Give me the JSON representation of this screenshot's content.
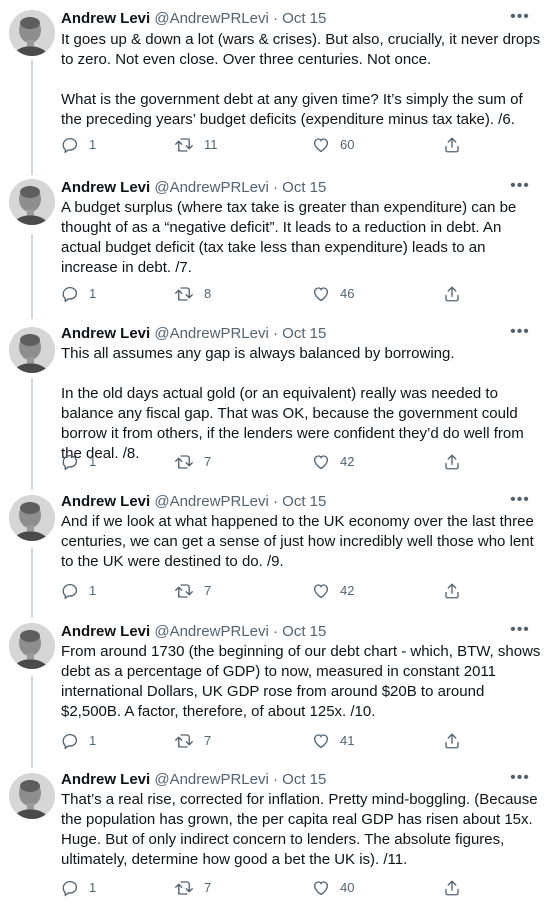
{
  "tweets": [
    {
      "name": "Andrew Levi",
      "handle": "@AndrewPRLevi",
      "dot": "·",
      "date": "Oct 15",
      "paragraphs": [
        "It goes up & down a lot (wars & crises). But also, crucially, it never drops to zero. Not even close. Over three centuries. Not once.",
        "What is the government debt at any given time? It’s simply the sum of the preceding years’ budget deficits (expenditure minus tax take). /6."
      ],
      "replies": "1",
      "retweets": "11",
      "likes": "60"
    },
    {
      "name": "Andrew Levi",
      "handle": "@AndrewPRLevi",
      "dot": "·",
      "date": "Oct 15",
      "paragraphs": [
        "A budget surplus (where tax take is greater than expenditure) can be thought of as a “negative deficit”. It leads to a reduction in debt. An actual budget deficit (tax take less than expenditure) leads to an increase in debt. /7."
      ],
      "replies": "1",
      "retweets": "8",
      "likes": "46"
    },
    {
      "name": "Andrew Levi",
      "handle": "@AndrewPRLevi",
      "dot": "·",
      "date": "Oct 15",
      "paragraphs": [
        "This all assumes any gap is always balanced by borrowing.",
        "In the old days actual gold (or an equivalent) really was needed to balance any fiscal gap. That was OK, because the government could borrow it from others, if the lenders were confident they’d do well from the deal. /8."
      ],
      "replies": "1",
      "retweets": "7",
      "likes": "42"
    },
    {
      "name": "Andrew Levi",
      "handle": "@AndrewPRLevi",
      "dot": "·",
      "date": "Oct 15",
      "paragraphs": [
        "And if we look at what happened to the UK economy over the last three centuries, we can get a sense of just how incredibly well those who lent to the UK were destined to do. /9."
      ],
      "replies": "1",
      "retweets": "7",
      "likes": "42"
    },
    {
      "name": "Andrew Levi",
      "handle": "@AndrewPRLevi",
      "dot": "·",
      "date": "Oct 15",
      "paragraphs": [
        "From around 1730 (the beginning of our debt chart - which, BTW, shows debt as a percentage of GDP) to now, measured in constant 2011 international Dollars, UK GDP rose from around $20B to around $2,500B. A factor, therefore, of about 125x. /10."
      ],
      "replies": "1",
      "retweets": "7",
      "likes": "41"
    },
    {
      "name": "Andrew Levi",
      "handle": "@AndrewPRLevi",
      "dot": "·",
      "date": "Oct 15",
      "paragraphs": [
        "That’s a real rise, corrected for inflation. Pretty mind-boggling. (Because the population has grown, the per capita real GDP has risen about 15x. Huge. But of only indirect concern to lenders. The absolute figures, ultimately, determine how good a bet the UK is). /11."
      ],
      "replies": "1",
      "retweets": "7",
      "likes": "40"
    }
  ]
}
